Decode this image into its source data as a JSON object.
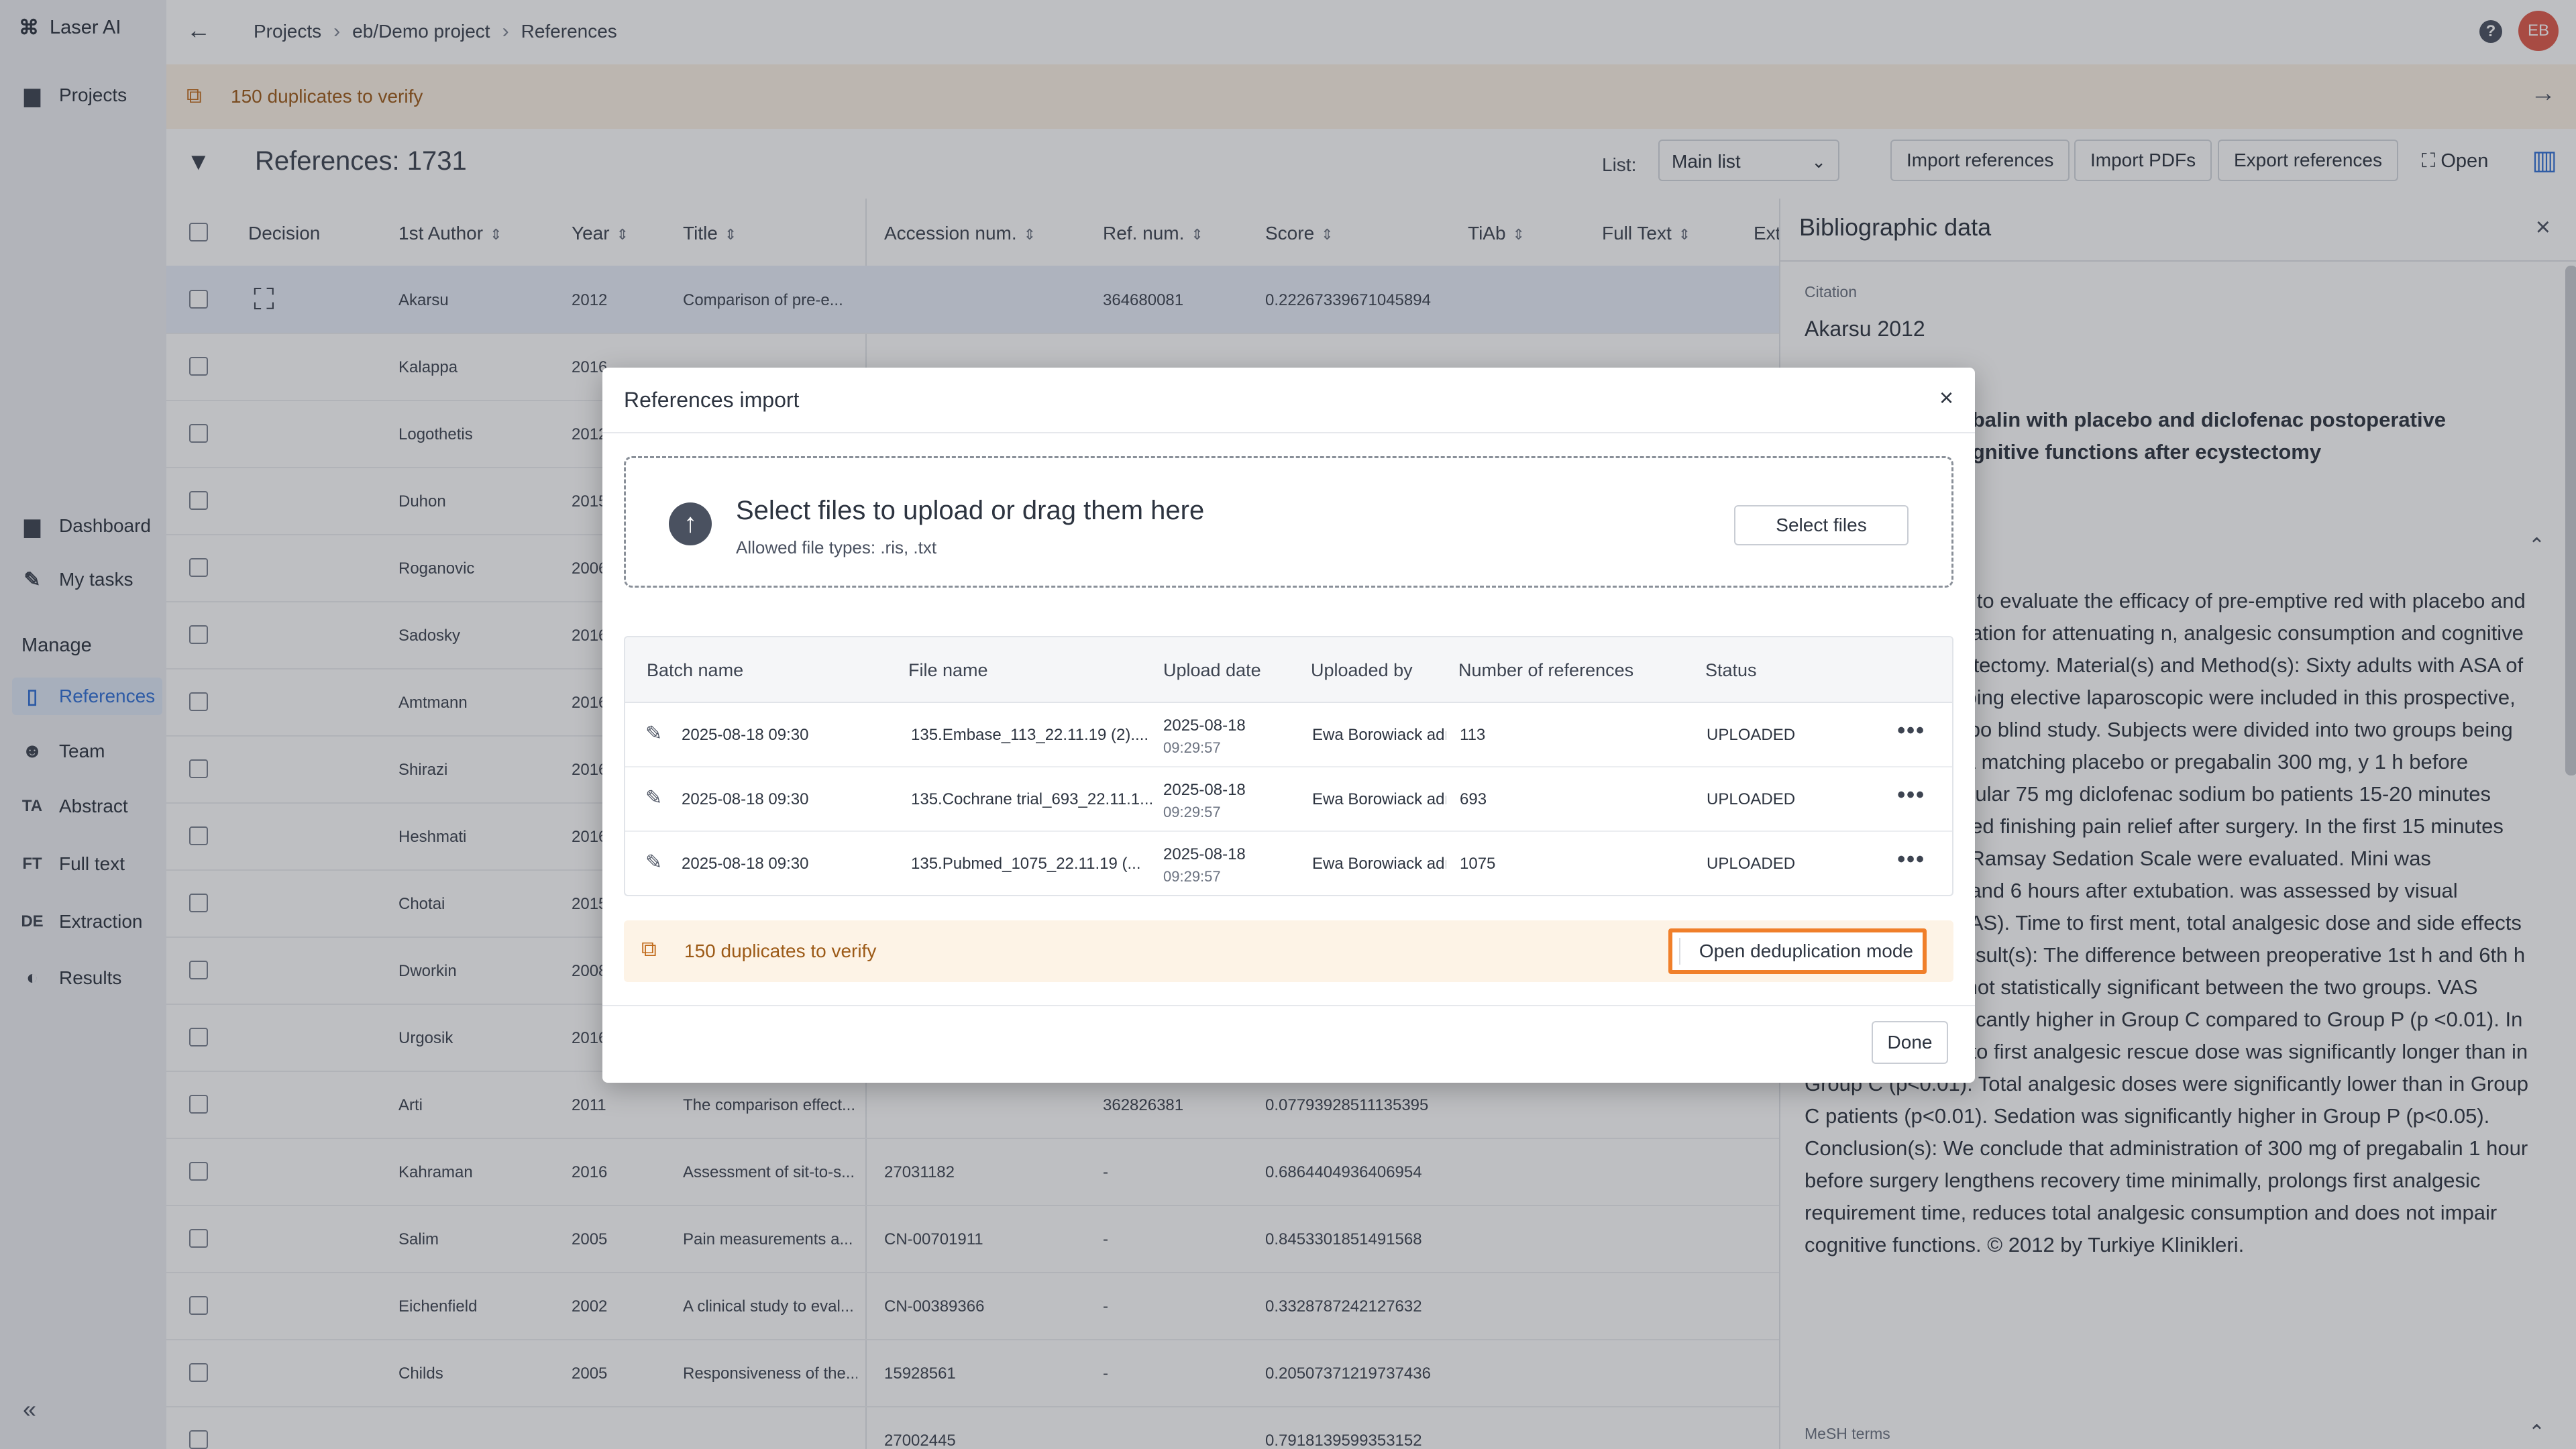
{
  "app": {
    "name": "Laser AI"
  },
  "sidebar": {
    "items": [
      {
        "label": "Projects",
        "icon": "folder-icon"
      },
      {
        "label": "Dashboard",
        "icon": "folder-icon"
      },
      {
        "label": "My tasks",
        "icon": "edit-icon"
      },
      {
        "label": "References",
        "icon": "document-icon",
        "active": true
      },
      {
        "label": "Team",
        "icon": "team-icon"
      },
      {
        "label": "Abstract",
        "icon": "TA"
      },
      {
        "label": "Full text",
        "icon": "FT"
      },
      {
        "label": "Extraction",
        "icon": "DE"
      },
      {
        "label": "Results",
        "icon": "results-icon"
      }
    ],
    "section_manage": "Manage",
    "collapse": "«"
  },
  "topbar": {
    "breadcrumb": [
      "Projects",
      "eb/Demo project",
      "References"
    ],
    "avatar": "EB"
  },
  "duplicates_banner": "150 duplicates to verify",
  "toolbar": {
    "ref_count": "References: 1731",
    "list_label": "List:",
    "list_value": "Main list",
    "import_refs": "Import references",
    "import_pdfs": "Import PDFs",
    "export_refs": "Export references",
    "open": "Open"
  },
  "table": {
    "columns": [
      "Decision",
      "1st Author",
      "Year",
      "Title",
      "Accession num.",
      "Ref. num.",
      "Score",
      "TiAb",
      "Full Text",
      "Ext"
    ],
    "rows": [
      {
        "author": "Akarsu",
        "year": "2012",
        "title": "Comparison of pre-e...",
        "accession": "",
        "ref": "364680081",
        "score": "0.22267339671045894"
      },
      {
        "author": "Kalappa",
        "year": "2016",
        "title": "",
        "accession": "",
        "ref": "",
        "score": ""
      },
      {
        "author": "Logothetis",
        "year": "2012",
        "title": "",
        "accession": "",
        "ref": "",
        "score": ""
      },
      {
        "author": "Duhon",
        "year": "2015",
        "title": "",
        "accession": "",
        "ref": "",
        "score": ""
      },
      {
        "author": "Roganovic",
        "year": "2006",
        "title": "",
        "accession": "",
        "ref": "",
        "score": ""
      },
      {
        "author": "Sadosky",
        "year": "2016",
        "title": "",
        "accession": "",
        "ref": "",
        "score": ""
      },
      {
        "author": "Amtmann",
        "year": "2016",
        "title": "",
        "accession": "",
        "ref": "",
        "score": ""
      },
      {
        "author": "Shirazi",
        "year": "2016",
        "title": "",
        "accession": "",
        "ref": "",
        "score": ""
      },
      {
        "author": "Heshmati",
        "year": "2016",
        "title": "",
        "accession": "",
        "ref": "",
        "score": ""
      },
      {
        "author": "Chotai",
        "year": "2015",
        "title": "",
        "accession": "",
        "ref": "",
        "score": ""
      },
      {
        "author": "Dworkin",
        "year": "2008",
        "title": "",
        "accession": "",
        "ref": "",
        "score": ""
      },
      {
        "author": "Urgosik",
        "year": "2016",
        "title": "",
        "accession": "",
        "ref": "",
        "score": ""
      },
      {
        "author": "Arti",
        "year": "2011",
        "title": "The comparison effect...",
        "accession": "",
        "ref": "362826381",
        "score": "0.07793928511135395"
      },
      {
        "author": "Kahraman",
        "year": "2016",
        "title": "Assessment of sit-to-s...",
        "accession": "27031182",
        "ref": "-",
        "score": "0.6864404936406954"
      },
      {
        "author": "Salim",
        "year": "2005",
        "title": "Pain measurements a...",
        "accession": "CN-00701911",
        "ref": "-",
        "score": "0.8453301851491568"
      },
      {
        "author": "Eichenfield",
        "year": "2002",
        "title": "A clinical study to eval...",
        "accession": "CN-00389366",
        "ref": "-",
        "score": "0.3328787242127632"
      },
      {
        "author": "Childs",
        "year": "2005",
        "title": "Responsiveness of the...",
        "accession": "15928561",
        "ref": "-",
        "score": "0.20507371219737436"
      },
      {
        "author": "",
        "year": "",
        "title": "",
        "accession": "27002445",
        "ref": "",
        "score": "0.7918139599353152"
      }
    ]
  },
  "right_panel": {
    "title": "Bibliographic data",
    "citation_label": "Citation",
    "citation": "Akarsu 2012",
    "title_text": "re-emptive pregabalin with placebo and diclofenac postoperative analgesia and cognitive functions after ecystectomy",
    "abstract": "dy was conducted to evaluate the efficacy of pre-emptive red with placebo and diclofenac combination for attenuating n, analgesic consumption and cognitive function after ecystectomy. Material(s) and Method(s): Sixty adults with ASA of either sex undergoing elective laparoscopic were included in this prospective, randomized placebo blind study. Subjects were divided into two groups being 30 receive either a matching placebo or pregabalin 300 mg, y 1 h before surgery. Intramuscular 75 mg diclofenac sodium bo patients 15-20 minutes before the estimated finishing pain relief after surgery. In the first 15 minutes after e Score and Ramsay Sedation Scale were evaluated. Mini was performed 1 hour and 6 hours after extubation. was assessed by visual analogue scale (VAS). Time to first ment, total analgesic dose and side effects were recorded. Result(s): The difference between preoperative 1st h and 6th h MMT values was not statistically significant between the two groups. VAS scores were significantly higher in Group C compared to Group P (p <0.01). In Group P, the time to first analgesic rescue dose was significantly longer than in Group C (p<0.01). Total analgesic doses were significantly lower than in Group C patients (p<0.01). Sedation was significantly higher in Group P (p<0.05). Conclusion(s): We conclude that administration of 300 mg of pregabalin 1 hour before surgery lengthens recovery time minimally, prolongs first analgesic requirement time, reduces total analgesic consumption and does not impair cognitive functions. © 2012 by Turkiye Klinikleri.",
    "mesh_label": "MeSH terms"
  },
  "modal": {
    "title": "References import",
    "dropzone_title": "Select files to upload or drag them here",
    "dropzone_sub": "Allowed file types: .ris, .txt",
    "select_files": "Select files",
    "columns": [
      "Batch name",
      "File name",
      "Upload date",
      "Uploaded by",
      "Number of references",
      "Status"
    ],
    "rows": [
      {
        "batch": "2025-08-18 09:30",
        "file": "135.Embase_113_22.11.19 (2)....",
        "date": "2025-08-18",
        "time": "09:29:57",
        "by": "Ewa Borowiack adı",
        "count": "113",
        "status": "UPLOADED"
      },
      {
        "batch": "2025-08-18 09:30",
        "file": "135.Cochrane trial_693_22.11.1...",
        "date": "2025-08-18",
        "time": "09:29:57",
        "by": "Ewa Borowiack adı",
        "count": "693",
        "status": "UPLOADED"
      },
      {
        "batch": "2025-08-18 09:30",
        "file": "135.Pubmed_1075_22.11.19 (...",
        "date": "2025-08-18",
        "time": "09:29:57",
        "by": "Ewa Borowiack adı",
        "count": "1075",
        "status": "UPLOADED"
      }
    ],
    "duplicates": "150 duplicates to verify",
    "dedup_button": "Open deduplication mode",
    "done": "Done"
  },
  "colors": {
    "accent": "#2f6fd6",
    "highlight": "#f07f2a",
    "warning_bg": "#fdf3e6",
    "warning_text": "#9c5a17"
  }
}
